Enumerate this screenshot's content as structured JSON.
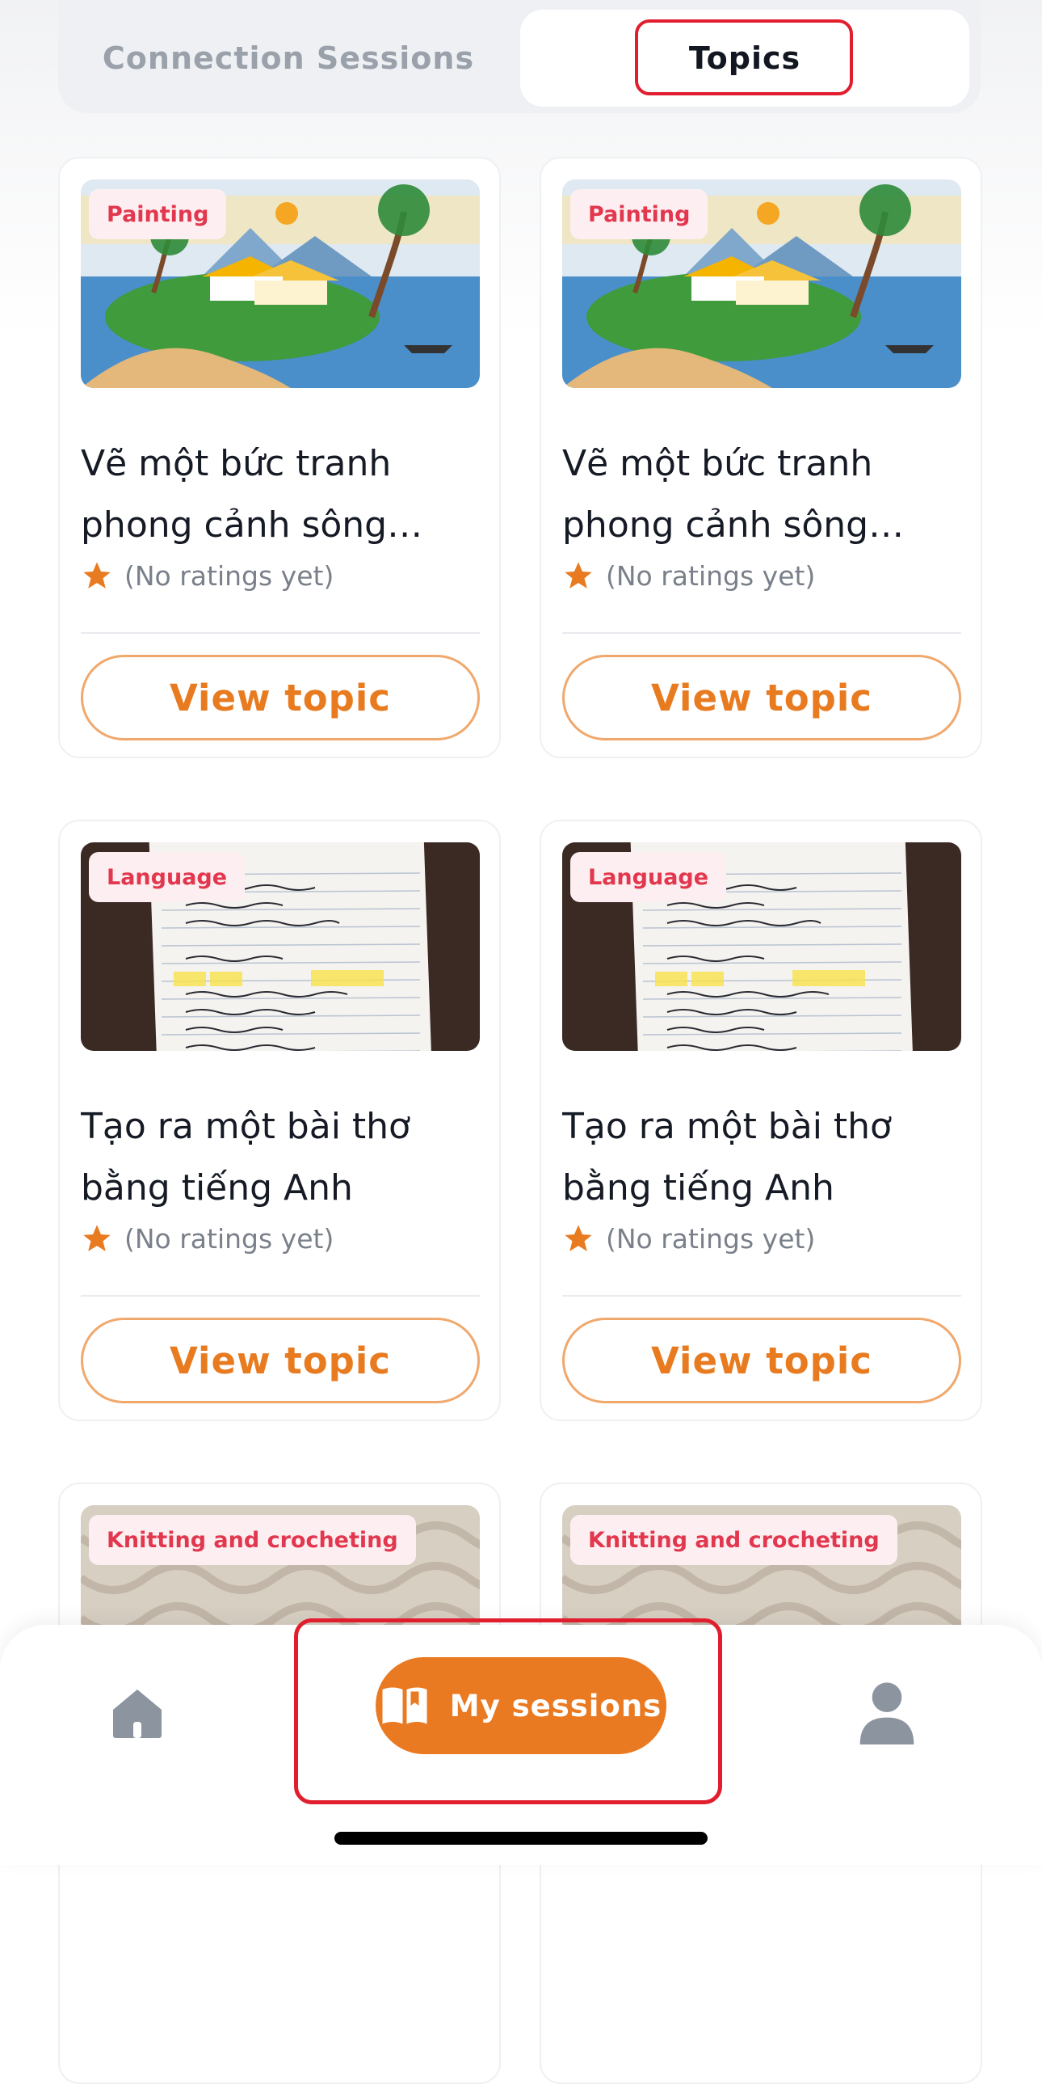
{
  "tabs": {
    "connection_sessions": "Connection Sessions",
    "topics": "Topics",
    "active": "topics"
  },
  "cards": [
    {
      "category": "Painting",
      "title": " Vẽ một bức tranh phong cảnh sông nước",
      "rating": "(No ratings yet)",
      "button": "View topic",
      "image": "painting-landscape"
    },
    {
      "category": "Painting",
      "title": " Vẽ một bức tranh phong cảnh sông nước",
      "rating": "(No ratings yet)",
      "button": "View topic",
      "image": "painting-landscape"
    },
    {
      "category": "Language",
      "title": "Tạo ra một bài thơ bằng tiếng Anh",
      "rating": "(No ratings yet)",
      "button": "View topic",
      "image": "handwritten-notebook"
    },
    {
      "category": "Language",
      "title": "Tạo ra một bài thơ bằng tiếng Anh",
      "rating": "(No ratings yet)",
      "button": "View topic",
      "image": "handwritten-notebook"
    },
    {
      "category": "Knitting and crocheting",
      "image": "macrame-texture"
    },
    {
      "category": "Knitting and crocheting",
      "image": "macrame-texture"
    }
  ],
  "bottom_nav": {
    "home_icon": "home-icon",
    "active_label": "My sessions",
    "active_icon": "open-book-icon",
    "profile_icon": "person-icon"
  },
  "colors": {
    "accent": "#ea7a22",
    "badge_text": "#e2374e",
    "highlight": "#e01e2e"
  }
}
